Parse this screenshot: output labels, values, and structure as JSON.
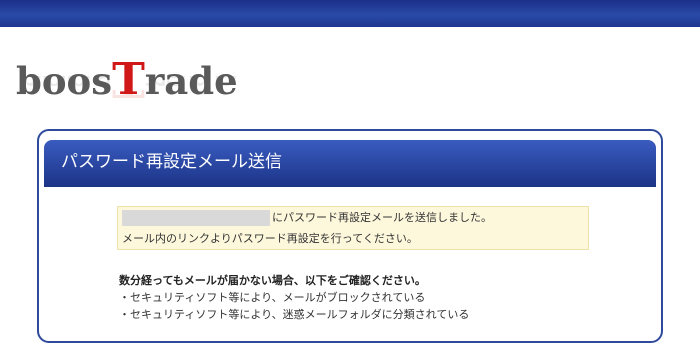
{
  "logo": {
    "prefix": "boos",
    "highlight": "T",
    "suffix": "rade"
  },
  "panel": {
    "title": "パスワード再設定メール送信",
    "notice": {
      "email_masked": "",
      "line1": "にパスワード再設定メールを送信しました。",
      "line2": "メール内のリンクよりパスワード再設定を行ってください。"
    },
    "help": {
      "title": "数分経ってもメールが届かない場合、以下をご確認ください。",
      "items": [
        "・セキュリティソフト等により、メールがブロックされている",
        "・セキュリティソフト等により、迷惑メールフォルダに分類されている"
      ]
    }
  },
  "colors": {
    "header_blue": "#2a47a3",
    "logo_red": "#d01818",
    "notice_bg": "#fdf8dc"
  }
}
